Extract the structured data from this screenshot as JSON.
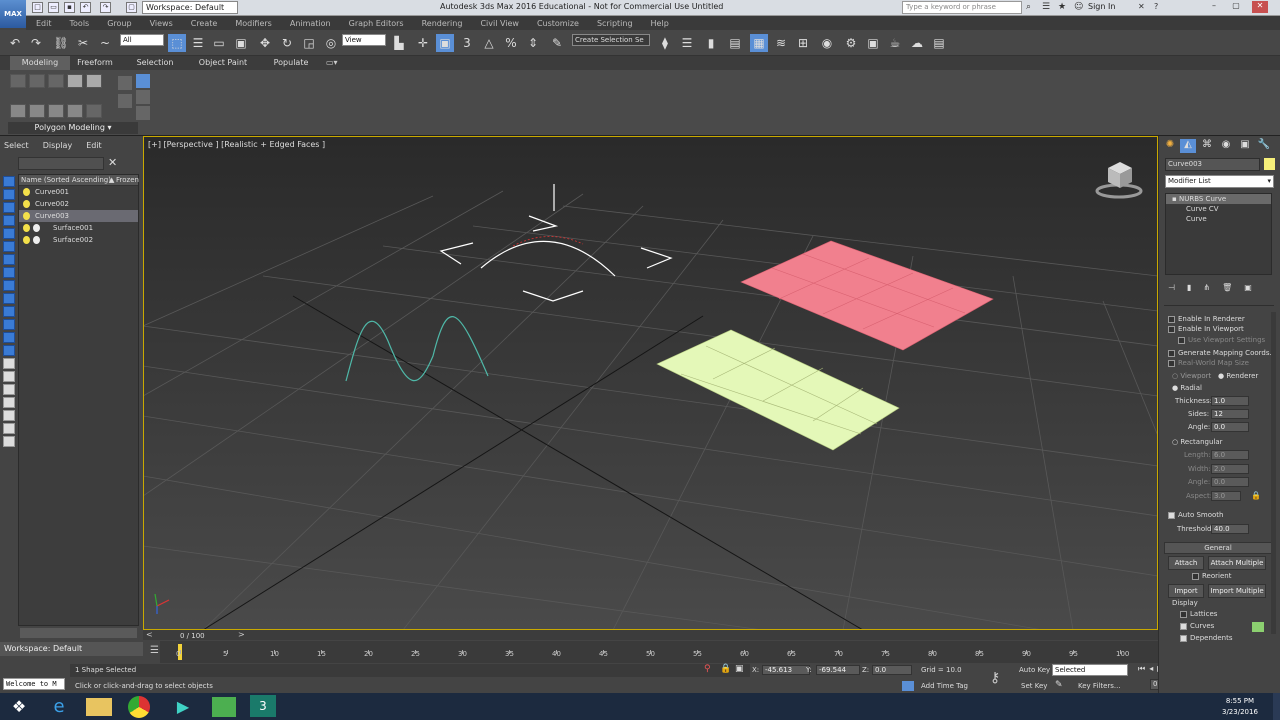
{
  "titlebar": {
    "title": "Autodesk 3ds Max 2016 Educational - Not for Commercial Use   Untitled",
    "logo": "MAX",
    "workspace": "Workspace: Default",
    "search_placeholder": "Type a keyword or phrase",
    "sign_in": "Sign In"
  },
  "menus": [
    "Edit",
    "Tools",
    "Group",
    "Views",
    "Create",
    "Modifiers",
    "Animation",
    "Graph Editors",
    "Rendering",
    "Civil View",
    "Customize",
    "Scripting",
    "Help"
  ],
  "toolbar": {
    "filter": "All",
    "ref_coord": "View",
    "selection_set": "Create Selection Se"
  },
  "ribbon": {
    "tabs": [
      "Modeling",
      "Freeform",
      "Selection",
      "Object Paint",
      "Populate"
    ],
    "active_tab": "Modeling",
    "panel_label": "Polygon Modeling"
  },
  "scene_explorer": {
    "menu": [
      "Select",
      "Display",
      "Edit"
    ],
    "header_name": "Name (Sorted Ascending)",
    "header_frozen": "Frozen",
    "items": [
      {
        "name": "Curve001",
        "selected": false
      },
      {
        "name": "Curve002",
        "selected": false
      },
      {
        "name": "Curve003",
        "selected": true
      },
      {
        "name": "Surface001",
        "selected": false
      },
      {
        "name": "Surface002",
        "selected": false
      }
    ],
    "workspace": "Workspace: Default"
  },
  "viewport": {
    "label": "[+] [Perspective ] [Realistic + Edged Faces ]"
  },
  "timeline": {
    "frame": "0 / 100",
    "ticks": [
      "0",
      "5",
      "10",
      "15",
      "20",
      "25",
      "30",
      "35",
      "40",
      "45",
      "50",
      "55",
      "60",
      "65",
      "70",
      "75",
      "80",
      "85",
      "90",
      "95",
      "100"
    ]
  },
  "status": {
    "selected": "1 Shape Selected",
    "prompt": "Click or click-and-drag to select objects",
    "maxscript": "Welcome to M",
    "x_label": "X:",
    "x": "-45.613",
    "y_label": "Y:",
    "y": "-69.544",
    "z_label": "Z:",
    "z": "0.0",
    "grid": "Grid = 10.0",
    "add_time_tag": "Add Time Tag",
    "auto_key": "Auto Key",
    "auto_key_mode": "Selected",
    "set_key": "Set Key",
    "key_filters": "Key Filters...",
    "frame_field": "0"
  },
  "command_panel": {
    "object_name": "Curve003",
    "object_color": "#f6f07a",
    "modifier_list": "Modifier List",
    "stack": [
      "NURBS Curve",
      "Curve CV",
      "Curve"
    ],
    "rendering": {
      "enable_renderer": "Enable In Renderer",
      "enable_viewport": "Enable In Viewport",
      "use_viewport": "Use Viewport Settings",
      "gen_mapping": "Generate Mapping Coords.",
      "real_world": "Real-World Map Size",
      "viewport": "Viewport",
      "renderer": "Renderer",
      "radial": "Radial",
      "thickness_label": "Thickness:",
      "thickness": "1.0",
      "sides_label": "Sides:",
      "sides": "12",
      "angle_label": "Angle:",
      "angle": "0.0",
      "rectangular": "Rectangular",
      "length_label": "Length:",
      "length": "6.0",
      "width_label": "Width:",
      "width": "2.0",
      "angle2_label": "Angle:",
      "angle2": "0.0",
      "aspect_label": "Aspect:",
      "aspect": "3.0",
      "auto_smooth": "Auto Smooth",
      "threshold_label": "Threshold:",
      "threshold": "40.0"
    },
    "general": {
      "title": "General",
      "attach": "Attach",
      "attach_multiple": "Attach Multiple",
      "reorient": "Reorient",
      "import": "Import",
      "import_multiple": "Import Multiple",
      "display": "Display",
      "lattices": "Lattices",
      "curves": "Curves",
      "dependents": "Dependents"
    }
  },
  "taskbar": {
    "time": "8:55 PM",
    "date": "3/23/2016"
  }
}
